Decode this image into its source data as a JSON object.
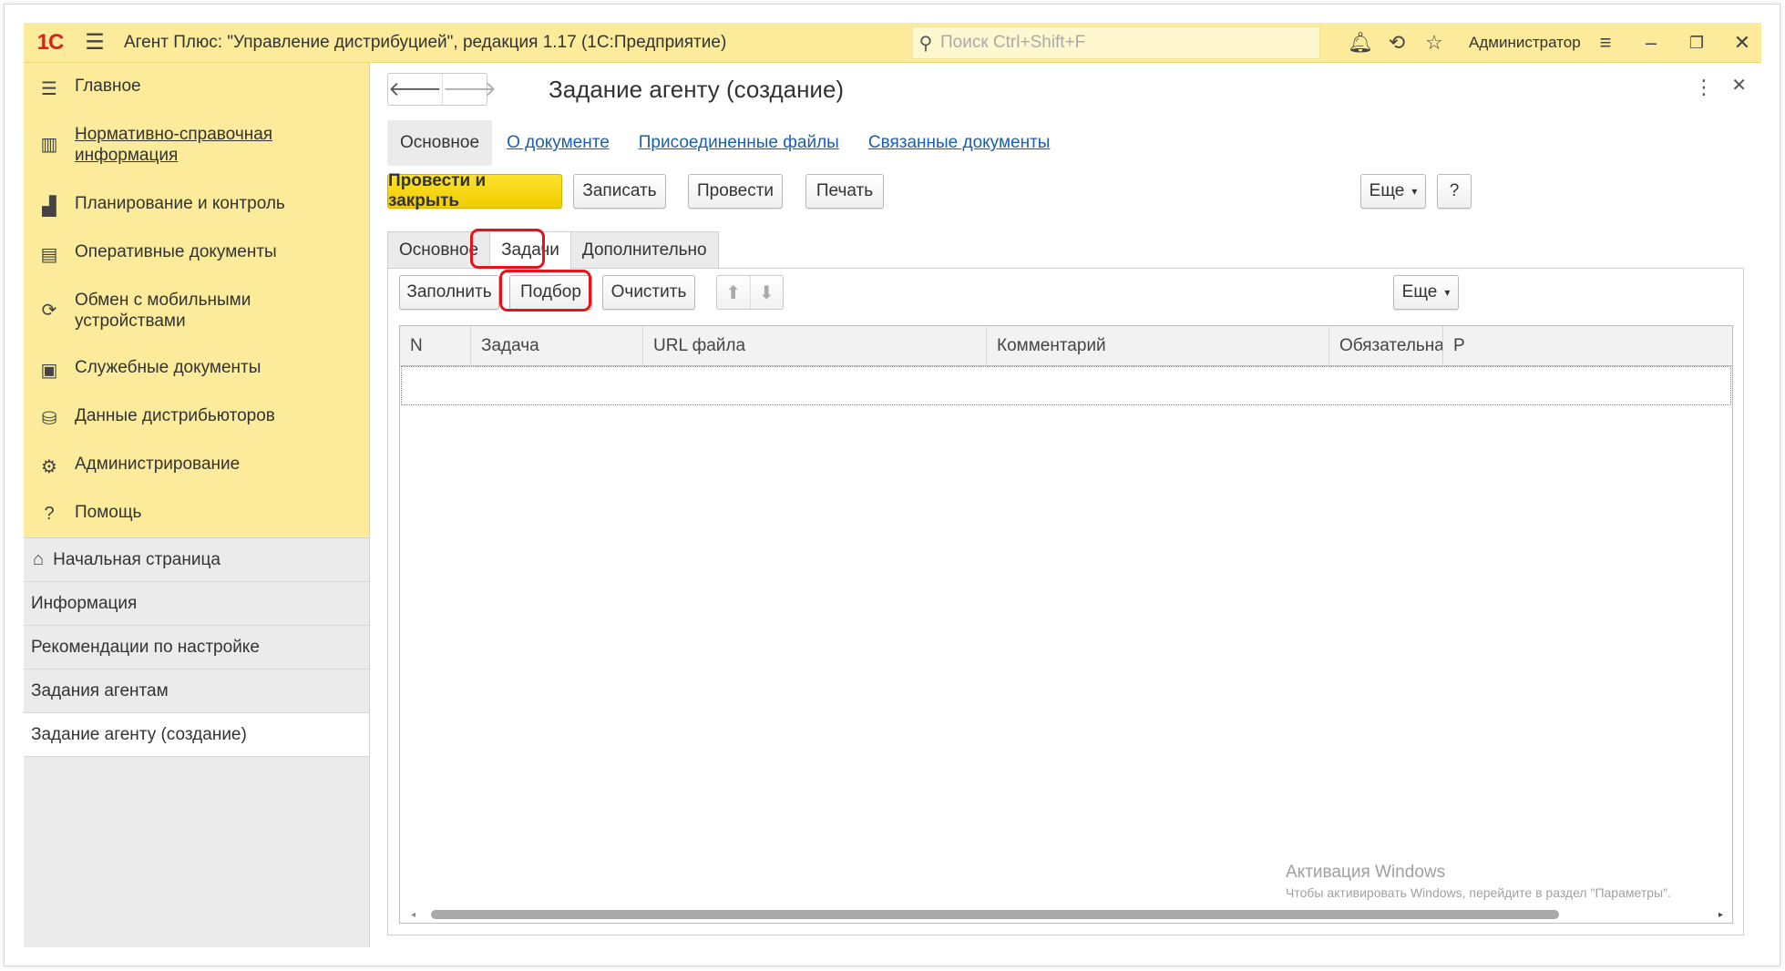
{
  "topbar": {
    "logo": "1С",
    "title": "Агент Плюс: \"Управление дистрибуцией\", редакция 1.17  (1С:Предприятие)",
    "search_placeholder": "Поиск Ctrl+Shift+F",
    "user": "Администратор"
  },
  "sidebar": {
    "items": [
      {
        "label": "Главное",
        "icon": "menu-icon"
      },
      {
        "label": "Нормативно-справочная информация",
        "icon": "catalog-icon"
      },
      {
        "label": "Планирование и контроль",
        "icon": "chart-icon"
      },
      {
        "label": "Оперативные документы",
        "icon": "documents-icon"
      },
      {
        "label": "Обмен с мобильными устройствами",
        "icon": "sync-icon"
      },
      {
        "label": "Служебные документы",
        "icon": "service-docs-icon"
      },
      {
        "label": "Данные дистрибьюторов",
        "icon": "distributor-icon"
      },
      {
        "label": "Администрирование",
        "icon": "gear-icon"
      },
      {
        "label": "Помощь",
        "icon": "help-icon"
      }
    ]
  },
  "subnav": {
    "items": [
      {
        "label": "Начальная страница"
      },
      {
        "label": "Информация"
      },
      {
        "label": "Рекомендации по настройке"
      },
      {
        "label": "Задания агентам"
      },
      {
        "label": "Задание агенту (создание)"
      }
    ]
  },
  "document": {
    "title": "Задание агенту (создание)",
    "tabs": [
      "Основное",
      "О документе",
      "Присоединенные файлы",
      "Связанные документы"
    ],
    "toolbar": {
      "post_close": "Провести и закрыть",
      "save": "Записать",
      "post": "Провести",
      "print": "Печать",
      "more": "Еще",
      "help": "?"
    },
    "form_tabs": [
      "Основное",
      "Задачи",
      "Дополнительно"
    ],
    "tasks_toolbar": {
      "fill": "Заполнить",
      "pick": "Подбор",
      "clear": "Очистить",
      "more": "Еще"
    },
    "table": {
      "columns": [
        "N",
        "Задача",
        "URL файла",
        "Комментарий",
        "Обязательная",
        "Р"
      ],
      "rows": []
    }
  },
  "watermark": {
    "line1": "Активация Windows",
    "line2": "Чтобы активировать Windows, перейдите в раздел \"Параметры\"."
  },
  "colors": {
    "accent_yellow": "#fbeb9a",
    "primary_button": "#f5d50a",
    "link": "#1b5fad",
    "highlight": "#e2161a"
  }
}
